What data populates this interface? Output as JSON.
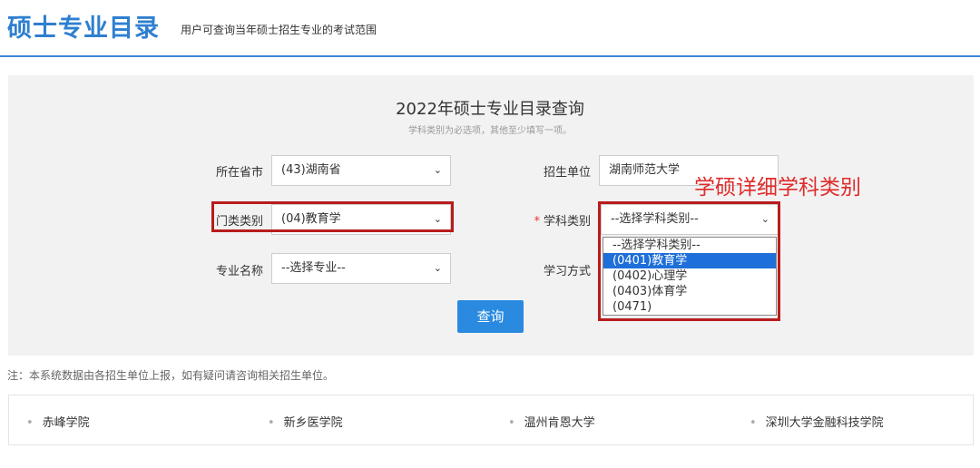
{
  "header": {
    "title": "硕士专业目录",
    "subtitle": "用户可查询当年硕士招生专业的考试范围"
  },
  "panel": {
    "title": "2022年硕士专业目录查询",
    "subtitle": "学科类别为必选项，其他至少填写一项。"
  },
  "form": {
    "province_label": "所在省市",
    "province_value": "(43)湖南省",
    "unit_label": "招生单位",
    "unit_value": "湖南师范大学",
    "category_label": "门类类别",
    "category_value": "(04)教育学",
    "required_mark": "*",
    "subject_label": "学科类别",
    "subject_value": "--选择学科类别--",
    "major_label": "专业名称",
    "major_value": "--选择专业--",
    "mode_label": "学习方式",
    "query_button": "查询"
  },
  "dropdown": {
    "options": [
      "--选择学科类别--",
      "(0401)教育学",
      "(0402)心理学",
      "(0403)体育学",
      "(0471)"
    ],
    "selected_index": 1
  },
  "annotation": "学硕详细学科类别",
  "note": "注：本系统数据由各招生单位上报，如有疑问请咨询相关招生单位。",
  "universities": [
    "赤峰学院",
    "新乡医学院",
    "温州肯恩大学",
    "深圳大学金融科技学院"
  ],
  "colors": {
    "brand": "#2f7fd0",
    "button": "#2a8ae0",
    "highlight": "#b81c1c",
    "annotation": "#e02b2b",
    "dropdown_selected": "#1e6fd9"
  }
}
